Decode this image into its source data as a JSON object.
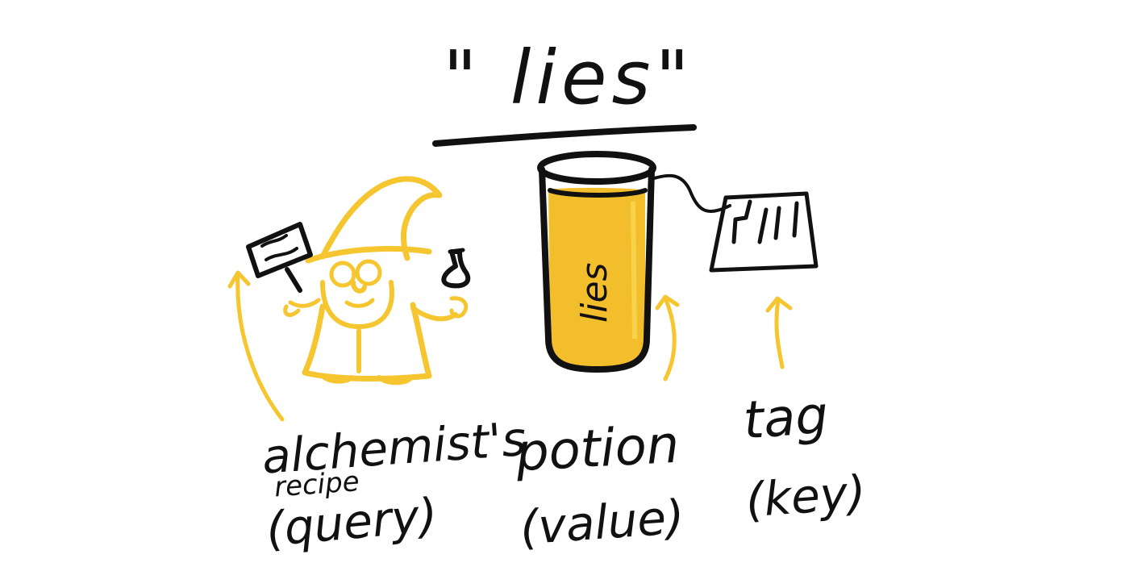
{
  "title": "\" lies\"",
  "potion_label": "lies",
  "labels": {
    "recipe_line1": "alchemist's",
    "recipe_line2": "recipe",
    "recipe_line3": "(query)",
    "potion_line1": "potion",
    "potion_line2": "(value)",
    "tag_line1": "tag",
    "tag_line2": "(key)"
  },
  "colors": {
    "ink": "#111111",
    "wizard": "#F6C630",
    "potion_fill": "#F3BE2B",
    "potion_highlight": "#F8D24A"
  }
}
